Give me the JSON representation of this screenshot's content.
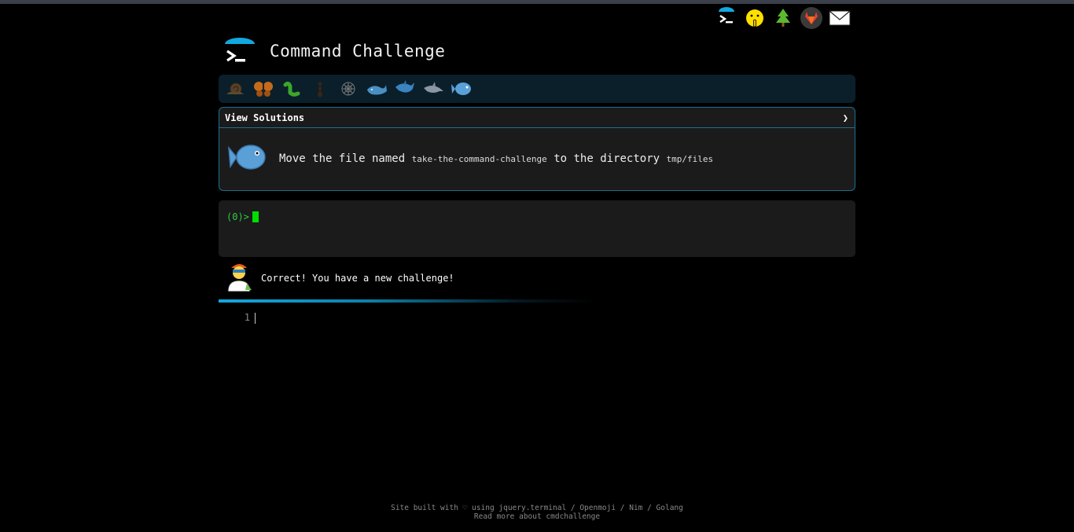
{
  "app": {
    "title": "Command Challenge"
  },
  "top_nav": {
    "icons": [
      "terminal-icon",
      "shushing-face-icon",
      "tree-icon",
      "gitlab-icon",
      "envelope-icon"
    ]
  },
  "levels": {
    "icons": [
      "snail-icon",
      "butterfly-icon",
      "bug-icon",
      "ant-icon",
      "web-icon",
      "whale-icon",
      "shark-icon",
      "dolphin-icon",
      "blowfish-icon"
    ]
  },
  "challenge": {
    "header_label": "View Solutions",
    "toggle_glyph": "❯",
    "text_prefix": "Move the file named ",
    "file_name": "take-the-command-challenge",
    "text_middle": " to the directory ",
    "dir_name": "tmp/files"
  },
  "terminal": {
    "prompt": "(0)>"
  },
  "feedback": {
    "message": "Correct! You have a new challenge!"
  },
  "editor": {
    "line_number": "1"
  },
  "footer": {
    "line1": "Site built with ♡ using jquery.terminal / Openmoji / Nim / Golang",
    "line2": "Read more about cmdchallenge"
  },
  "colors": {
    "accent": "#12a8e0",
    "prompt_green": "#2ecc40",
    "card_border": "#1d6f8f"
  }
}
